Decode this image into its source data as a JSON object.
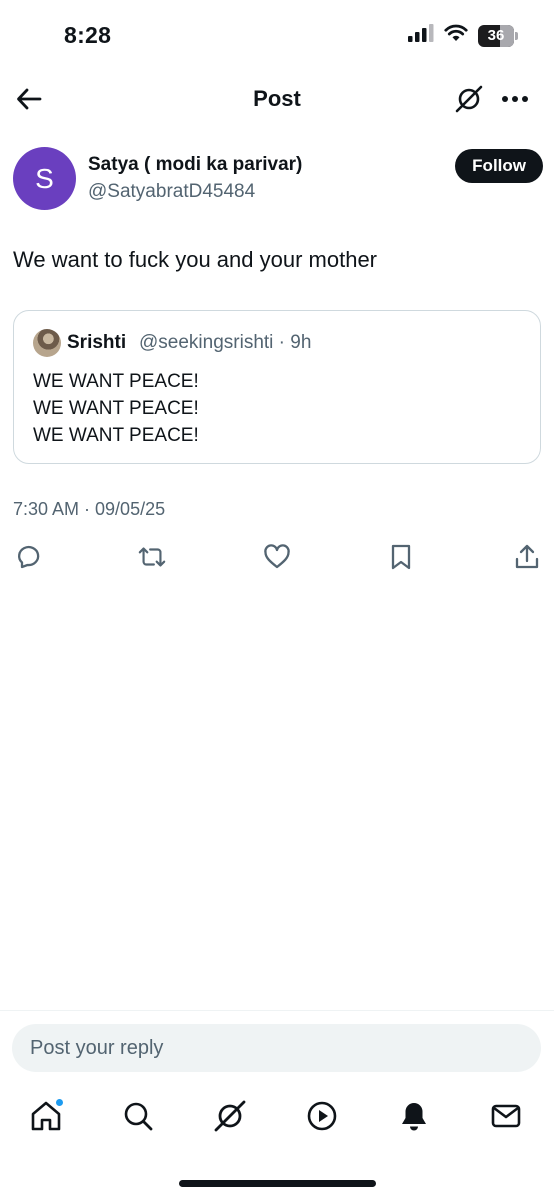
{
  "status_bar": {
    "time": "8:28",
    "battery": "36",
    "icons": [
      "cellular-signal-icon",
      "wifi-icon",
      "battery-icon"
    ]
  },
  "header": {
    "title": "Post",
    "icons": [
      "back-arrow-icon",
      "grok-icon",
      "more-icon"
    ]
  },
  "post": {
    "author": {
      "avatar_letter": "S",
      "avatar_color": "#6a3fbf",
      "name": "Satya ( modi ka parivar)",
      "handle": "@SatyabratD45484"
    },
    "follow_label": "Follow",
    "text": "We want to fuck you and your mother",
    "quote": {
      "name": "Srishti",
      "meta": "@seekingsrishti · 9h",
      "lines": [
        "WE WANT PEACE!",
        "WE WANT PEACE!",
        "WE WANT PEACE!"
      ]
    },
    "timestamp": "7:30 AM · 09/05/25",
    "actions": [
      "reply-icon",
      "repost-icon",
      "like-icon",
      "bookmark-icon",
      "share-icon"
    ]
  },
  "reply": {
    "placeholder": "Post your reply"
  },
  "tab_bar": {
    "tabs": [
      "home-icon",
      "search-icon",
      "grok-icon",
      "video-icon",
      "notifications-icon",
      "messages-icon"
    ]
  },
  "colors": {
    "text": "#0f1419",
    "secondary": "#536471",
    "accent": "#1d9bf0",
    "border": "#cfd9de"
  }
}
